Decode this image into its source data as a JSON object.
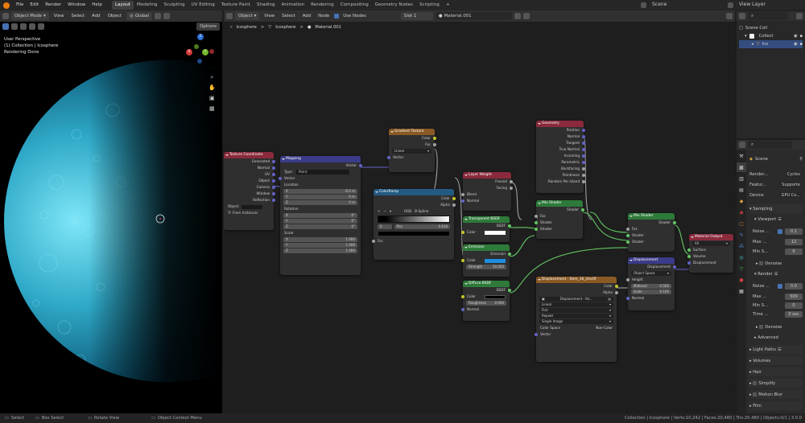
{
  "topbar": {
    "menu": [
      "File",
      "Edit",
      "Render",
      "Window",
      "Help"
    ],
    "workspaces": [
      "Layout",
      "Modeling",
      "Sculpting",
      "UV Editing",
      "Texture Paint",
      "Shading",
      "Animation",
      "Rendering",
      "Compositing",
      "Geometry Nodes",
      "Scripting"
    ],
    "active_workspace": "Layout",
    "add_tab": "+",
    "scene": "Scene",
    "view_layer": "View Layer"
  },
  "viewport": {
    "mode": "Object Mode",
    "menu": [
      "View",
      "Select",
      "Add",
      "Object"
    ],
    "transform": "Global",
    "options": "Options",
    "overlay_lines": [
      "User Perspective",
      "(1) Collection | Icosphere",
      "Rendering Done"
    ],
    "gizmo": {
      "x": "X",
      "y": "Y",
      "z": "Z"
    }
  },
  "node_editor": {
    "type": "Object",
    "menu": [
      "View",
      "Select",
      "Add",
      "Node"
    ],
    "use_nodes": "Use Nodes",
    "slot": "Slot 1",
    "material": "Material.001",
    "breadcrumb": [
      "Icosphere",
      "Icosphere",
      "Material.001"
    ],
    "sep": ">",
    "nodes": {
      "texcoord": {
        "title": "Texture Coordinate",
        "outputs": [
          "Generated",
          "Normal",
          "UV",
          "Object",
          "Camera",
          "Window",
          "Reflection"
        ],
        "object_label": "Object",
        "from_instancer": "From Instancer"
      },
      "mapping": {
        "title": "Mapping",
        "out": "Vector",
        "type_label": "Type:",
        "type_val": "Point",
        "in_vector": "Vector",
        "location": "Location",
        "loc": [
          [
            "X",
            "-0.2 m"
          ],
          [
            "Y",
            "0 m"
          ],
          [
            "Z",
            "0 m"
          ]
        ],
        "rotation": "Rotation",
        "rot": [
          [
            "X",
            "0°"
          ],
          [
            "Y",
            "0°"
          ],
          [
            "Z",
            "0°"
          ]
        ],
        "scale": "Scale",
        "scl": [
          [
            "X",
            "1.000"
          ],
          [
            "Y",
            "1.000"
          ],
          [
            "Z",
            "1.000"
          ]
        ]
      },
      "gradient": {
        "title": "Gradient Texture",
        "outputs": [
          "Color",
          "Fac"
        ],
        "mode": "Linear",
        "in": "Vector"
      },
      "colorramp": {
        "title": "ColorRamp",
        "outputs": [
          "Color",
          "Alpha"
        ],
        "plus": "+",
        "minus": "−",
        "mode": "RGB",
        "interp": "B-Spline",
        "stop": "0",
        "pos_label": "Pos",
        "pos": "0.638",
        "in": "Fac"
      },
      "layerweight": {
        "title": "Layer Weight",
        "outputs": [
          "Fresnel",
          "Facing"
        ],
        "inputs": [
          "Blend",
          "Normal"
        ]
      },
      "transparent": {
        "title": "Transparent BSDF",
        "out": "BSDF",
        "in": "Color"
      },
      "emission": {
        "title": "Emission",
        "out": "Emission",
        "in_color": "Color",
        "strength_label": "Strength",
        "strength": "50.000"
      },
      "diffuse": {
        "title": "Diffuse BSDF",
        "out": "BSDF",
        "in_color": "Color",
        "rough_label": "Roughness",
        "rough": "0.000",
        "in_normal": "Normal"
      },
      "geometry": {
        "title": "Geometry",
        "outputs": [
          "Position",
          "Normal",
          "Tangent",
          "True Normal",
          "Incoming",
          "Parametric",
          "Backfacing",
          "Pointiness",
          "Random Per Island"
        ]
      },
      "mixshader1": {
        "title": "Mix Shader",
        "out": "Shader",
        "inputs": [
          "Fac",
          "Shader",
          "Shader"
        ]
      },
      "mixshader2": {
        "title": "Mix Shader",
        "out": "Shader",
        "inputs": [
          "Fac",
          "Shader",
          "Shader"
        ]
      },
      "imagetex": {
        "title": "Displacement - Item_16_Unc0f",
        "outputs": [
          "Color",
          "Alpha"
        ],
        "img": "Displacement - Ite...",
        "opts": [
          "Linear",
          "Flat",
          "Repeat",
          "Single Image"
        ],
        "cs_label": "Color Space",
        "cs": "Non-Color",
        "in": "Vector"
      },
      "displacement": {
        "title": "Displacement",
        "out": "Displacement",
        "space": "Object Space",
        "in_height": "Height",
        "mid_label": "Midlevel",
        "mid": "0.500",
        "scale_label": "Scale",
        "scale": "0.100",
        "in_normal": "Normal"
      },
      "output": {
        "title": "Material Output",
        "target": "All",
        "inputs": [
          "Surface",
          "Volume",
          "Displacement"
        ]
      }
    }
  },
  "outliner": {
    "scene_coll": "Scene Coll",
    "collection": "Collect",
    "object": "Ico"
  },
  "properties": {
    "scene": "Scene",
    "rows": [
      [
        "Render...",
        "Cycles"
      ],
      [
        "Featur...",
        "Supporte"
      ],
      [
        "Device",
        "GPU Co..."
      ]
    ],
    "sampling": "Sampling",
    "viewport": "Viewport",
    "vp_rows": [
      [
        "Noise ...",
        "0.1"
      ],
      [
        "Max ...",
        "12"
      ],
      [
        "Min S...",
        "0"
      ]
    ],
    "denoise": "Denoise",
    "render": "Render",
    "r_rows": [
      [
        "Noise ...",
        "0.0"
      ],
      [
        "Max ...",
        "500"
      ],
      [
        "Min S...",
        "0"
      ],
      [
        "Time ...",
        "0 sec"
      ]
    ],
    "advanced": "Advanced",
    "sections": [
      "Light Paths",
      "Volumes",
      "Hair",
      "Simplify",
      "Motion Blur",
      "Film"
    ]
  },
  "status": {
    "items": [
      "Select",
      "Box Select",
      "Rotate View",
      "Object Context Menu"
    ],
    "info": "Collection | Icosphere | Verts:10,242 | Faces:20,480 | Tris:20,480 | Objects:0/1 | 3.0.0"
  }
}
